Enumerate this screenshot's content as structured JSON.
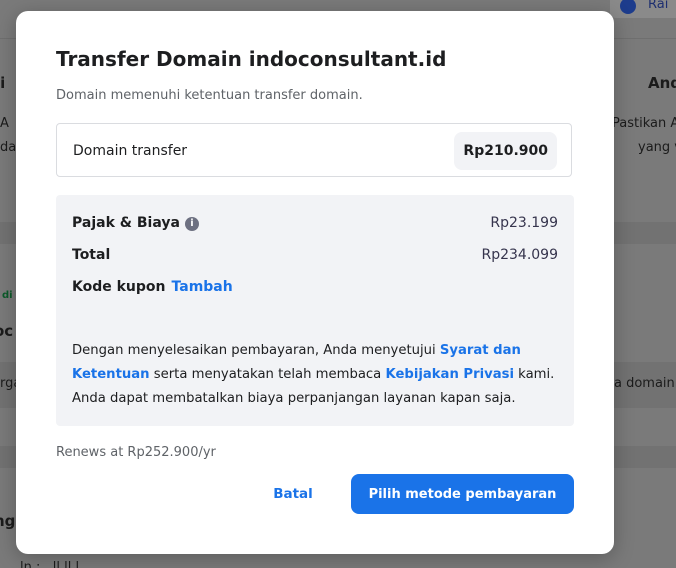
{
  "background": {
    "pill_label": "Rai",
    "fragments": {
      "left_heading": "ai",
      "left_line1": "A",
      "left_line2": "da",
      "right_heading": "And",
      "right_line1": "Pastikan A",
      "right_line2": "yang v",
      "green_label": "di",
      "left_heading2": "oc",
      "left_line3": "rga",
      "right_line3": "a domain",
      "left_heading3": "ng",
      "bottom_text": "ln  :  ,  ll  ll  l"
    }
  },
  "modal": {
    "title": "Transfer Domain indoconsultant.id",
    "subtitle": "Domain memenuhi ketentuan transfer domain.",
    "line_item": {
      "name": "Domain transfer",
      "price": "Rp210.900"
    },
    "summary": {
      "tax_label": "Pajak & Biaya",
      "tax_value": "Rp23.199",
      "total_label": "Total",
      "total_value": "Rp234.099",
      "coupon_label": "Kode kupon",
      "coupon_link": "Tambah"
    },
    "terms": {
      "part1": "Dengan menyelesaikan pembayaran, Anda menyetujui ",
      "link1": "Syarat dan Ketentuan",
      "part2": " serta menyatakan telah membaca ",
      "link2": "Kebijakan Privasi",
      "part3": " kami. Anda dapat membatalkan biaya perpanjangan layanan kapan saja."
    },
    "renews": "Renews at Rp252.900/yr",
    "cancel_label": "Batal",
    "primary_label": "Pilih metode pembayaran"
  },
  "colors": {
    "accent": "#1a73e8",
    "overlay": "#7a7a7a",
    "summary_bg": "#f2f3f6"
  },
  "icons": {
    "info": "info-icon",
    "badge": "badge-icon"
  }
}
